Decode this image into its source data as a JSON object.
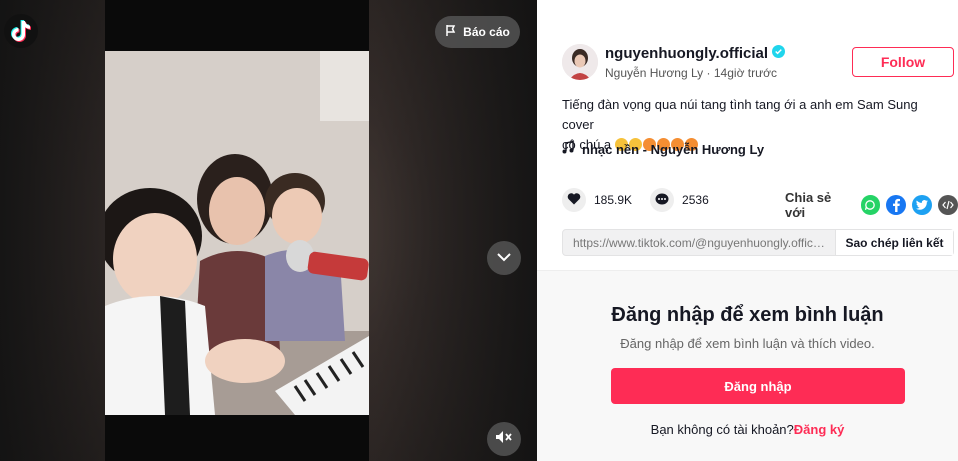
{
  "video": {
    "report_label": "Báo cáo"
  },
  "author": {
    "username": "nguyenhuongly.official",
    "display_name": "Nguyễn Hương Ly",
    "time_ago": "14giờ trước",
    "follow_label": "Follow"
  },
  "caption": {
    "line1": "Tiếng đàn vọng qua núi tang tình tang ới a anh em Sam Sung cover",
    "line2": "cô chú ạ"
  },
  "music": {
    "label": "nhạc nền - Nguyễn Hương Ly"
  },
  "stats": {
    "likes": "185.9K",
    "comments": "2536",
    "share_label": "Chia sẻ với"
  },
  "link": {
    "url": "https://www.tiktok.com/@nguyenhuongly.offici...",
    "copy_label": "Sao chép liên kết"
  },
  "comments": {
    "title": "Đăng nhập để xem bình luận",
    "subtitle": "Đăng nhập để xem bình luận và thích video.",
    "login_label": "Đăng nhập",
    "signup_prompt": "Bạn không có tài khoản?",
    "signup_label": "Đăng ký"
  },
  "colors": {
    "accent": "#fe2c55",
    "verified": "#20d5ec",
    "whatsapp": "#25d366",
    "facebook": "#1877f2",
    "twitter": "#1da1f2"
  },
  "icons": [
    "tiktok-logo-icon",
    "flag-icon",
    "chevron-down-icon",
    "mute-icon",
    "verified-icon",
    "music-note-icon",
    "heart-icon",
    "comment-icon",
    "whatsapp-icon",
    "facebook-icon",
    "twitter-icon",
    "embed-icon"
  ]
}
